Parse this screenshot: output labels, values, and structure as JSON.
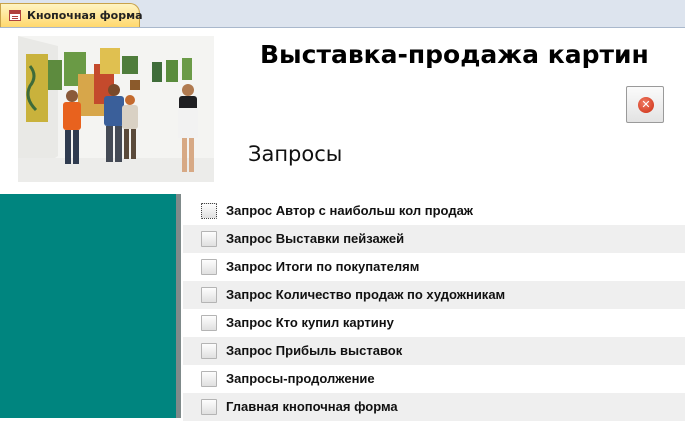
{
  "tab": {
    "label": "Кнопочная форма",
    "icon": "form-icon"
  },
  "header": {
    "title": "Выставка-продажа картин",
    "section": "Запросы"
  },
  "close_button": {
    "icon": "close-icon"
  },
  "menu": {
    "items": [
      {
        "label": "Запрос Автор с наибольш кол продаж"
      },
      {
        "label": "Запрос Выставки пейзажей"
      },
      {
        "label": "Запрос Итоги по покупателям"
      },
      {
        "label": "Запрос Количество продаж по художникам"
      },
      {
        "label": "Запрос Кто купил картину"
      },
      {
        "label": "Запрос Прибыль выставок"
      },
      {
        "label": "Запросы-продолжение"
      },
      {
        "label": "Главная кнопочная форма"
      }
    ]
  },
  "colors": {
    "side_panel": "#00857f",
    "tab": "#ffd86e",
    "row_alt": "#efefef"
  }
}
